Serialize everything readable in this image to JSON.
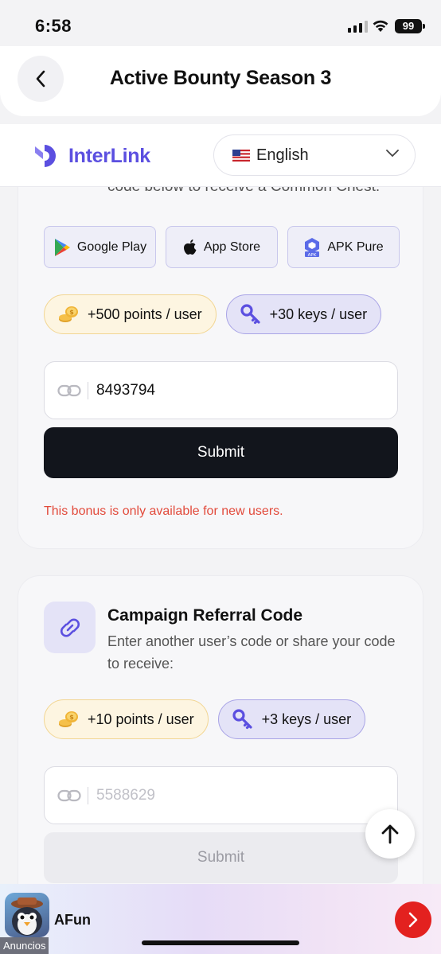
{
  "status_bar": {
    "time": "6:58",
    "battery": "99"
  },
  "header": {
    "title": "Active Bounty Season 3"
  },
  "brand": {
    "name": "InterLink"
  },
  "language": {
    "label": "English"
  },
  "card1": {
    "partial_text": "code below to receive a Common Chest:",
    "stores": [
      {
        "label": "Google Play"
      },
      {
        "label": "App Store"
      },
      {
        "label": "APK Pure",
        "badge": "APK"
      }
    ],
    "points_pill": "+500 points / user",
    "keys_pill": "+30 keys / user",
    "code_value": "8493794",
    "submit_label": "Submit",
    "note": "This bonus is only available for new users."
  },
  "card2": {
    "title": "Campaign Referral Code",
    "description": "Enter another user’s code or share your code to receive:",
    "points_pill": "+10 points / user",
    "keys_pill": "+3 keys / user",
    "code_placeholder": "5588629",
    "submit_label": "Submit"
  },
  "ad": {
    "app_name": "AFun",
    "tag": "Anuncios"
  },
  "colors": {
    "brand": "#5b4fe0",
    "error": "#e24a3b",
    "primary_button": "#12151c",
    "ad_button": "#e3211f"
  },
  "icons": [
    "back-icon",
    "chevron-down-icon",
    "link-icon",
    "coins-icon",
    "key-icon",
    "arrow-up-icon",
    "chevron-right-icon"
  ]
}
